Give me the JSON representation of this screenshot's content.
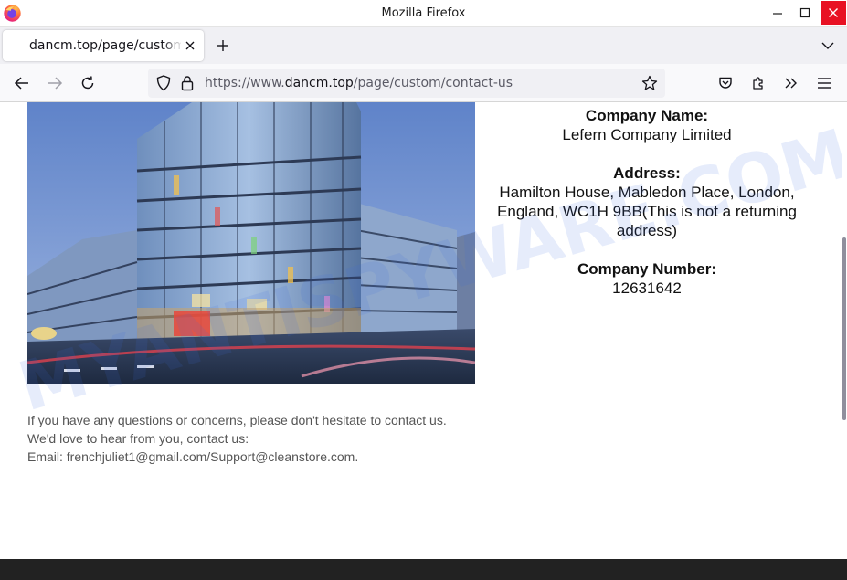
{
  "window": {
    "title": "Mozilla Firefox"
  },
  "tab": {
    "title": "dancm.top/page/custom/contact-us"
  },
  "urlbar": {
    "prefix": "https://www.",
    "domain": "dancm.top",
    "path": "/page/custom/contact-us"
  },
  "company": {
    "name_label": "Company Name:",
    "name_value": "Lefern Company Limited",
    "address_label": "Address:",
    "address_value": "Hamilton House, Mabledon Place, London, England, WC1H 9BB(This is not a returning address)",
    "number_label": "Company Number:",
    "number_value": "12631642"
  },
  "contact": {
    "line1": "If you have any questions or concerns, please don't hesitate to contact us.",
    "line2": "We'd love to hear from you, contact us:",
    "line3": "Email: frenchjuliet1@gmail.com/Support@cleanstore.com."
  },
  "watermark": {
    "text": "MYANTISPYWARE.COM"
  },
  "colors": {
    "close_button": "#e81123",
    "firefox_orange": "#ff7139",
    "firefox_purple": "#7542e5",
    "footer": "#222222"
  }
}
